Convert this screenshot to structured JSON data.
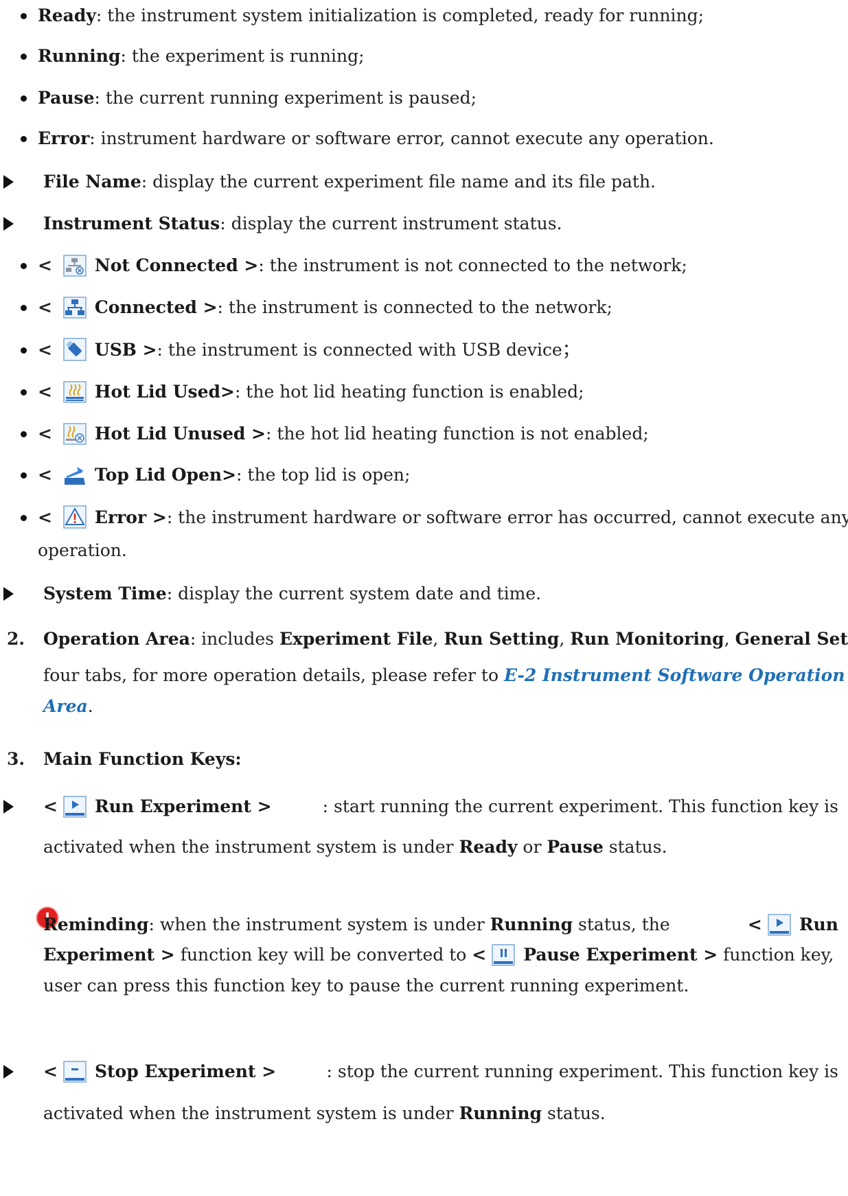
{
  "status_items": [
    {
      "term": "Ready",
      "desc": ": the instrument system initialization is completed, ready for running;"
    },
    {
      "term": "Running",
      "desc": ": the experiment is running;"
    },
    {
      "term": "Pause",
      "desc": ": the current running experiment is paused;"
    },
    {
      "term": "Error",
      "desc": ": instrument hardware or software error, cannot execute any operation."
    }
  ],
  "file_name": {
    "term": "File Name",
    "desc": ": display the current experiment file name and its file path."
  },
  "instrument_status": {
    "term": "Instrument Status",
    "desc": ": display the current instrument status."
  },
  "lt": "<",
  "icon_items": [
    {
      "term": "Not Connected >",
      "desc": ": the instrument is not connected to the network;",
      "icon": "network-disconnected-icon"
    },
    {
      "term": "Connected >",
      "desc": ": the instrument is connected to the network;",
      "icon": "network-connected-icon"
    },
    {
      "term": "USB >",
      "desc": ": the instrument is connected with USB device；",
      "icon": "usb-icon"
    },
    {
      "term": "Hot Lid Used>",
      "desc": ": the hot lid heating function is enabled;",
      "icon": "hot-lid-used-icon"
    },
    {
      "term": "Hot Lid Unused >",
      "desc": ": the hot lid heating function is not enabled;",
      "icon": "hot-lid-unused-icon"
    },
    {
      "term": "Top Lid Open>",
      "desc": ": the top lid is open;",
      "icon": "top-lid-open-icon"
    },
    {
      "term": "Error >",
      "desc": ": the instrument hardware or software error has occurred, cannot execute any",
      "desc2": "operation.",
      "icon": "warning-triangle-icon"
    }
  ],
  "system_time": {
    "term": "System Time",
    "desc": ": display the current system date and time."
  },
  "operation_area": {
    "number": "2.",
    "term": "Operation Area",
    "intro": ": includes ",
    "tab1": "Experiment File",
    "sep": ", ",
    "tab2": "Run Setting",
    "tab3": "Run Monitoring",
    "tab4": "General Setting",
    "line2_text": "four tabs, for more operation details, please refer to ",
    "link1": "E-2 Instrument Software Operation",
    "link2": "Area",
    "period": "."
  },
  "main_keys": {
    "number": "3.",
    "title": "Main Function Keys:"
  },
  "run_experiment": {
    "term": "Run Experiment >",
    "desc": ": start running the current experiment. This function key is",
    "line2_pre": "activated when the instrument system is under ",
    "ready": "Ready",
    "or": " or ",
    "pause": "Pause",
    "status": " status."
  },
  "reminding": {
    "term": "Reminding",
    "text1": ": when the instrument system is under ",
    "running": "Running",
    "text2": " status, the ",
    "run": "Run",
    "experiment": "Experiment >",
    "text3": " function key will be converted to ",
    "pause_exp": "Pause Experiment >",
    "text4": " function key,",
    "line3": "user can press this function key to pause the current running experiment."
  },
  "stop_experiment": {
    "term": "Stop Experiment >",
    "desc": ": stop the current running experiment. This function key is",
    "line2_pre": "activated when the instrument system is under ",
    "running": "Running",
    "status": " status."
  }
}
